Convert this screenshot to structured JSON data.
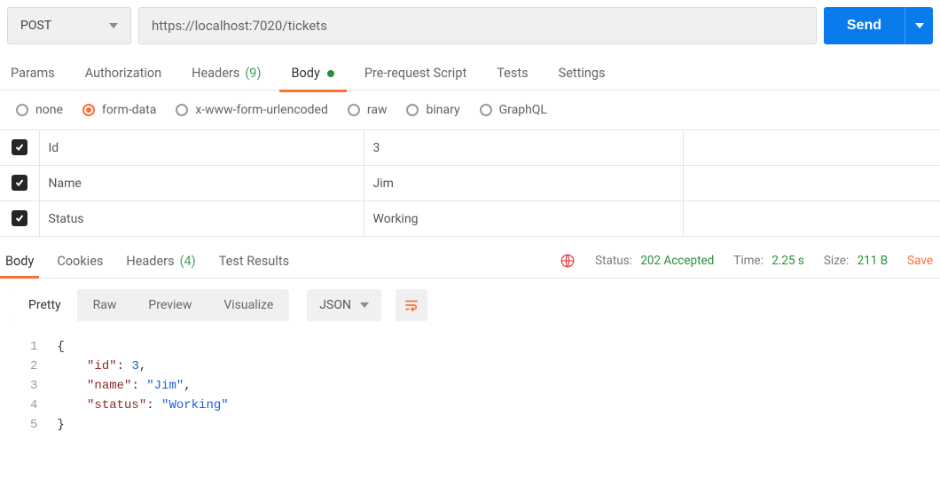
{
  "request": {
    "method": "POST",
    "url": "https://localhost:7020/tickets"
  },
  "send_button_label": "Send",
  "request_tabs": {
    "params": "Params",
    "authorization": "Authorization",
    "headers_label": "Headers",
    "headers_count": "(9)",
    "body": "Body",
    "prerequest": "Pre-request Script",
    "tests": "Tests",
    "settings": "Settings"
  },
  "body_types": {
    "none": "none",
    "formdata": "form-data",
    "xwww": "x-www-form-urlencoded",
    "raw": "raw",
    "binary": "binary",
    "graphql": "GraphQL"
  },
  "form_rows": [
    {
      "key": "Id",
      "value": "3"
    },
    {
      "key": "Name",
      "value": "Jim"
    },
    {
      "key": "Status",
      "value": "Working"
    }
  ],
  "response_tabs": {
    "body": "Body",
    "cookies": "Cookies",
    "headers_label": "Headers",
    "headers_count": "(4)",
    "test_results": "Test Results"
  },
  "response_meta": {
    "status_label": "Status:",
    "status_value": "202 Accepted",
    "time_label": "Time:",
    "time_value": "2.25 s",
    "size_label": "Size:",
    "size_value": "211 B",
    "save_label": "Save"
  },
  "view_modes": {
    "pretty": "Pretty",
    "raw": "Raw",
    "preview": "Preview",
    "visualize": "Visualize",
    "language": "JSON"
  },
  "response_json": {
    "id": 3,
    "name": "Jim",
    "status": "Working"
  }
}
